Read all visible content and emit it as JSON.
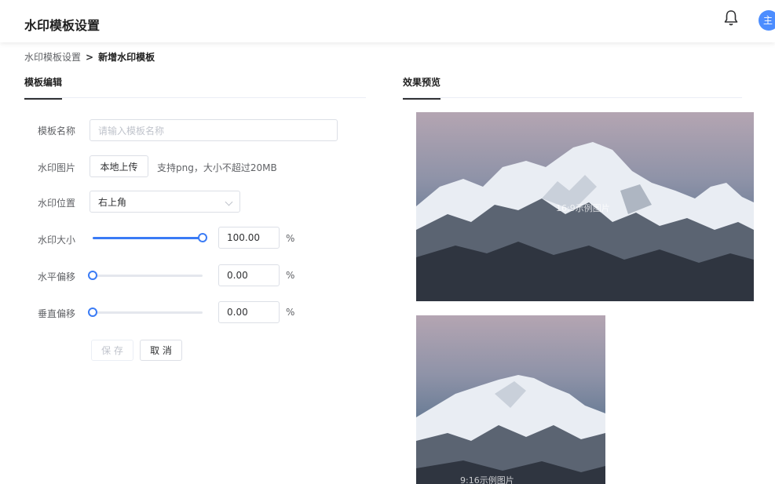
{
  "header": {
    "title": "水印模板设置",
    "avatar_text": "主"
  },
  "breadcrumb": {
    "parent": "水印模板设置",
    "separator": ">",
    "current": "新增水印模板"
  },
  "tabs": {
    "editor": "模板编辑",
    "preview": "效果预览"
  },
  "form": {
    "name": {
      "label": "模板名称",
      "placeholder": "请输入模板名称"
    },
    "image": {
      "label": "水印图片",
      "upload_button": "本地上传",
      "hint": "支持png，大小不超过20MB"
    },
    "position": {
      "label": "水印位置",
      "value": "右上角"
    },
    "size": {
      "label": "水印大小",
      "value": "100.00",
      "unit": "%",
      "slider_value": 100
    },
    "h_offset": {
      "label": "水平偏移",
      "value": "0.00",
      "unit": "%",
      "slider_value": 0
    },
    "v_offset": {
      "label": "垂直偏移",
      "value": "0.00",
      "unit": "%",
      "slider_value": 0
    },
    "save_button": "保 存",
    "cancel_button": "取 消"
  },
  "preview": {
    "landscape_label": "16:9示例图片",
    "portrait_label": "9:16示例图片"
  },
  "colors": {
    "accent": "#3a7bf5",
    "avatar": "#4c8dff"
  }
}
